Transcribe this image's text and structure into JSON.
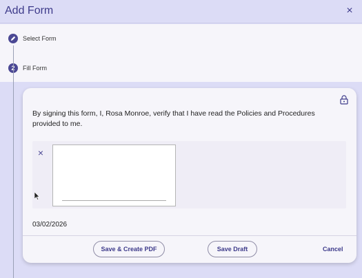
{
  "header": {
    "title": "Add Form",
    "close_icon": "×"
  },
  "steps": [
    {
      "number": "",
      "label": "Select Form",
      "icon": "pencil-icon"
    },
    {
      "number": "2",
      "label": "Fill Form"
    }
  ],
  "form": {
    "statement": "By signing this form, I, Rosa Monroe, verify that I have read the Policies and Procedures provided to me.",
    "clear_signature_icon": "×",
    "date": "03/02/2026",
    "lock_icon": "lock-icon"
  },
  "actions": {
    "save_create_pdf": "Save & Create PDF",
    "save_draft": "Save Draft",
    "cancel": "Cancel"
  },
  "colors": {
    "accent": "#3d3a8a",
    "step_circle": "#4b4894",
    "background": "#dcdcf6",
    "panel": "#f6f5fa"
  }
}
